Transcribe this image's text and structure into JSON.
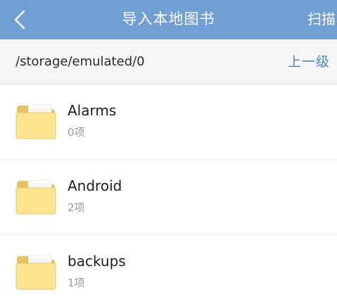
{
  "header": {
    "title": "导入本地图书",
    "back_icon": "chevron-left-icon",
    "scan_label": "扫描",
    "background_color": "#6f9fd4"
  },
  "path_bar": {
    "current_path": "/storage/emulated/0",
    "up_label": "上一级",
    "up_color": "#4f86c6"
  },
  "files": [
    {
      "name": "Alarms",
      "count": "0项",
      "icon": "folder-icon"
    },
    {
      "name": "Android",
      "count": "2项",
      "icon": "folder-icon"
    },
    {
      "name": "backups",
      "count": "1项",
      "icon": "folder-icon"
    }
  ]
}
